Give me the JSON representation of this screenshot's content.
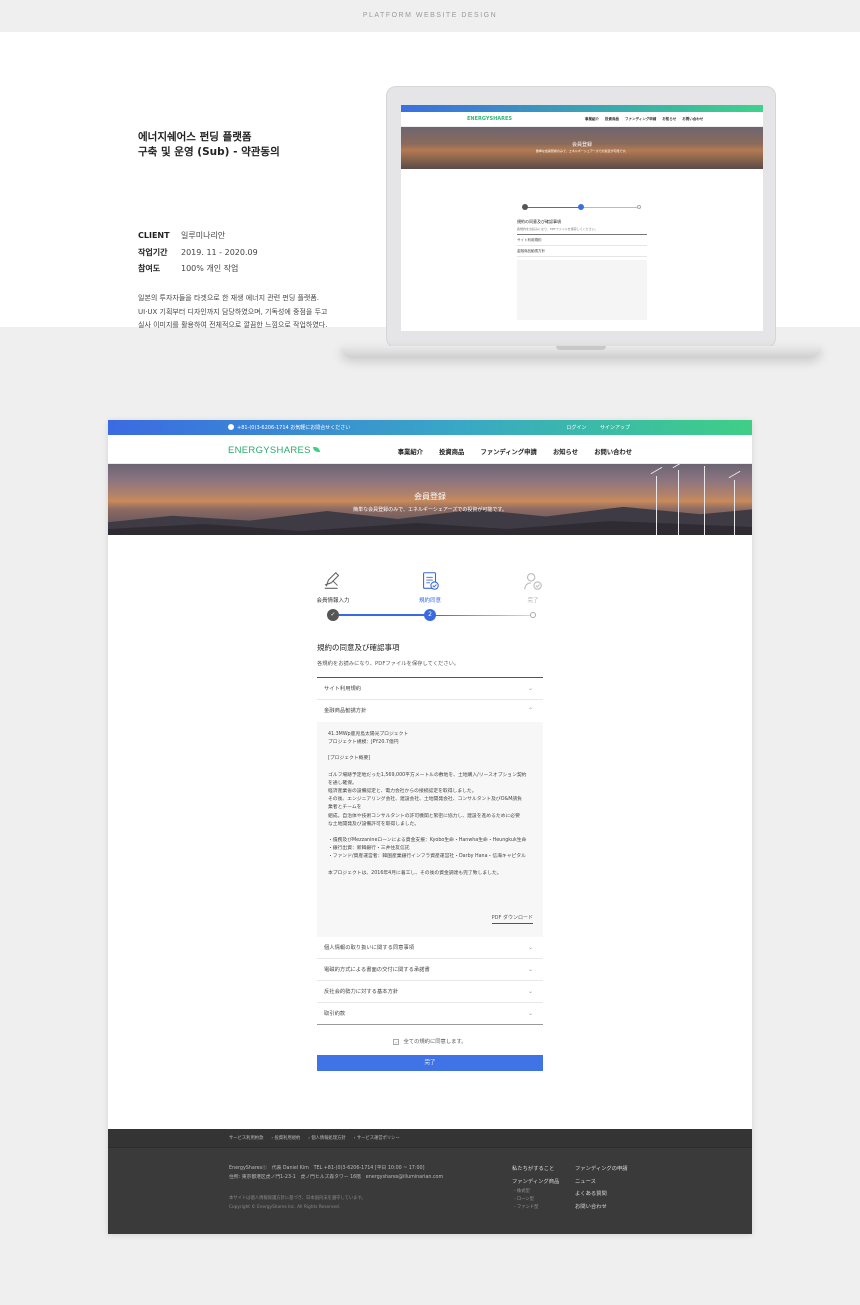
{
  "page_label": "PLATFORM WEBSITE DESIGN",
  "intro": {
    "title_line1": "에너지쉐어스 펀딩 플랫폼",
    "title_line2": "구축 및 운영 (Sub) - 약관동의",
    "meta": [
      {
        "k": "CLIENT",
        "v": "일루미나리안"
      },
      {
        "k": "작업기간",
        "v": "2019. 11 - 2020.09"
      },
      {
        "k": "참여도",
        "v": "100% 개인 작업"
      }
    ],
    "desc_lines": [
      "일본의 투자자들을 타겟으로 한 재생 에너지 관련 펀딩 플랫폼.",
      "UI·UX 기획부터 디자인까지 담당하였으며, 기독성에 중점을 두고",
      "실사 이미지를 활용하여 전체적으로 깔끔한 느낌으로 작업하였다."
    ]
  },
  "site": {
    "topbar": {
      "phone": "+81-(0)3-6206-1714 お気軽にお問合せください",
      "login": "ログイン",
      "signup": "サインアップ"
    },
    "logo": "ENERGYSHARES",
    "menu": [
      "事業紹介",
      "投資商品",
      "ファンディング申請",
      "お知らせ",
      "お問い合わせ"
    ],
    "hero": {
      "title": "会員登録",
      "subtitle": "簡単な会員登録のみで、エネルギーシェアーズでの投資が可能です。"
    },
    "steps": [
      {
        "label": "会員情報入力",
        "num": ""
      },
      {
        "label": "規約同意",
        "num": "2"
      },
      {
        "label": "完了",
        "num": ""
      }
    ],
    "section_title": "規約の同意及び確認事項",
    "section_sub": "各規約をお読みになり、PDFファイルを保存してください。",
    "accordion_top": [
      {
        "label": "サイト利用規約",
        "chev": "⌄"
      },
      {
        "label": "金融商品勧誘方針",
        "chev": "⌃"
      }
    ],
    "accordion_body": [
      "41.3MWp鹿児島太陽光プロジェクト",
      "プロジェクト規模：JPY20.7億円",
      "",
      "[プロジェクト概要]",
      "",
      "ゴルフ場跡予定地だった1,569,000平方メートルの敷地を、土地購入/リースオプション契約",
      "を通し確保。",
      "経済産業省の設備認定と、電力会社からの接続認定を取得しました。",
      "その後、エンジニアリング会社、建設会社、土地開発会社、コンサルタント及びO&M請負",
      "業者とチームを",
      "組成。自治体や技術コンサルタントの許可機関と緊密に協力し、建設を進めるために必要",
      "な土地開発及び設備許可を取得しました。",
      "",
      "・債務及びMezzanineローンによる資金支援：Kyobo生命・Hanwha生命・Heungkuk生命",
      "・銀行出資：新韓銀行・三井住友信託",
      "・ファンド/資産運営者：韓国産業銀行インフラ資産運営社・Darby Hana・信海キャピタル",
      "",
      "本プロジェクトは、2016年4月に着工し、その後の資金調達も完了致しました。"
    ],
    "pdf": "PDF ダウンロード",
    "accordion_bottom": [
      {
        "label": "個人情報の取り扱いに関する同意事項",
        "chev": "⌄"
      },
      {
        "label": "電磁的方式による書面の交付に関する承諾書",
        "chev": "⌄"
      },
      {
        "label": "反社会的勢力に対する基本方針",
        "chev": "⌄"
      },
      {
        "label": "取引約款",
        "chev": "⌄"
      }
    ],
    "agree_all": "全ての規約に同意します。",
    "done_button": "完了",
    "footer": {
      "links": [
        "サービス利用約款",
        "投資利用規約",
        "個人情報処理方針",
        "サービス運営ポリシー"
      ],
      "info1": "EnergySharesⓒ　代表 Daniel Kim　TEL +81-(0)3-6206-1714 [平日 10:00 ~ 17:00]",
      "info2": "住所: 東京都港区虎ノ門1-23-1　虎ノ門ヒルズ森タワー 16階　energyshares@illuminarian.com",
      "notice": "本サイトは個人情報保護方針に基づき、日本国内法を遵守しています。",
      "copy": "Copyright © EnergyShares Inc. All Rights Reserved.",
      "col1": [
        "私たちがすること",
        "ファンディング商品"
      ],
      "col1_sub": [
        "- 株式型",
        "- ローン型",
        "- ファンド型"
      ],
      "col2": [
        "ファンディングの申請",
        "ニュース",
        "よくある質問",
        "お問い合わせ"
      ]
    }
  },
  "colors": {
    "primary": "#3f73e6",
    "green": "#3ecf86",
    "footer": "#3a3a3a"
  }
}
